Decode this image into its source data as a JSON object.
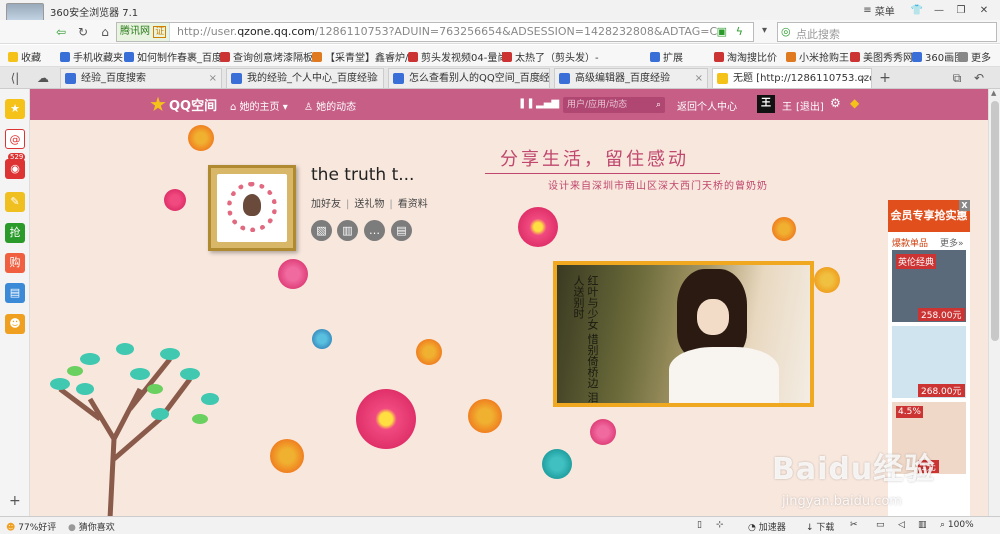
{
  "browser": {
    "app_title": "360安全浏览器 7.1",
    "menu_label": "菜单",
    "url_site_tag": "腾讯网",
    "url_cert": "证",
    "url_prefix": "http://user.",
    "url_domain": "qzone.qq.com",
    "url_rest": "/1286110753?ADUIN=763256654&ADSESSION=1428232808&ADTAG=CLIENT.QQ.5",
    "search_placeholder": "点此搜索"
  },
  "bookmarks": [
    {
      "label": "收藏",
      "color": "#f5c21a"
    },
    {
      "label": "手机收藏夹",
      "color": "#3a6fd8"
    },
    {
      "label": "如何制作春裹_百度",
      "color": "#3a6fd8"
    },
    {
      "label": "查询创意烤漆隔板",
      "color": "#c33"
    },
    {
      "label": "【采青堂】鑫睿炉/",
      "color": "#e07a20"
    },
    {
      "label": "剪头发视频04-量尚",
      "color": "#c33"
    },
    {
      "label": "太热了（剪头发）-",
      "color": "#c33"
    },
    {
      "label": "扩展",
      "color": "#3a6fd8"
    },
    {
      "label": "淘淘搜比价",
      "color": "#c33"
    },
    {
      "label": "小米抢购王",
      "color": "#e07a20"
    },
    {
      "label": "美图秀秀网",
      "color": "#c33"
    },
    {
      "label": "360画图",
      "color": "#3a6fd8"
    },
    {
      "label": "更多",
      "color": "#888"
    }
  ],
  "tabs": [
    {
      "label": "经验_百度搜索"
    },
    {
      "label": "我的经验_个人中心_百度经验"
    },
    {
      "label": "怎么查看别人的QQ空间_百度经"
    },
    {
      "label": "高级编辑器_百度经验"
    },
    {
      "label": "无题 [http://1286110753.qzone."
    }
  ],
  "sidebar": {
    "badge_count": "529"
  },
  "qzone": {
    "logo": "QQ空间",
    "nav_home": "她的主页",
    "nav_feed": "她的动态",
    "search_placeholder": "用户/应用/动态",
    "back_personal": "返回个人中心",
    "user_name": "王",
    "logout": "[退出]"
  },
  "profile": {
    "nickname": "the truth t...",
    "add_friend": "加好友",
    "send_gift": "送礼物",
    "view_profile": "看资料"
  },
  "banner": {
    "slogan": "分享生活，留住感动",
    "subline": "设计来自深圳市南山区深大西门天桥的曾奶奶",
    "calligraphy": "红叶与少女 惜别倚桥边 泪人送别时"
  },
  "ad": {
    "header": "会员专享抢实惠",
    "close": "X",
    "sub_left": "爆款单品",
    "sub_right": "更多»",
    "items": [
      {
        "price": "258.00元",
        "bg": "#5a6a7a",
        "label": "英伦经典"
      },
      {
        "price": "268.00元",
        "bg": "#cfe4ef",
        "label": ""
      },
      {
        "price": "1元",
        "bg": "#f0d8c8",
        "label": "4.5%"
      }
    ]
  },
  "watermark": {
    "brand": "Baidu经验",
    "url": "jingyan.baidu.com"
  },
  "status": {
    "rating": "77%好评",
    "guess": "猜你喜欢",
    "accelerator": "加速器",
    "download": "下载",
    "zoom": "100%"
  }
}
